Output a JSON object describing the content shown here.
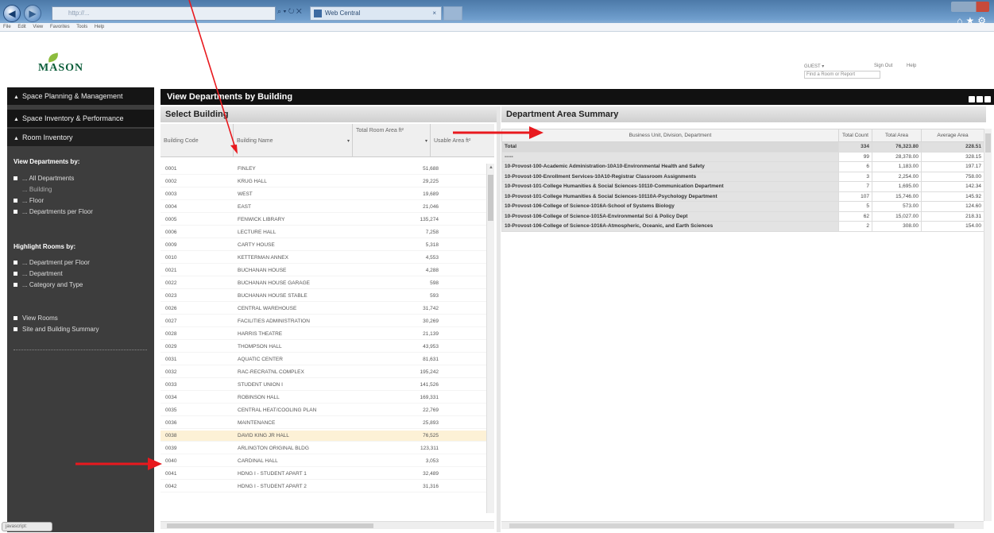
{
  "browser": {
    "address_text": "http://...",
    "tab_label": "Web Central",
    "menu": [
      "File",
      "Edit",
      "View",
      "Favorites",
      "Tools",
      "Help"
    ]
  },
  "header": {
    "logo_text": "MASON",
    "user_label": "GUEST ▾",
    "sign_out": "Sign Out",
    "help": "Help",
    "find_room_placeholder": "Find a Room or Report"
  },
  "sidebar": {
    "sections": [
      "Space Planning & Management",
      "Space Inventory & Performance",
      "Room Inventory"
    ],
    "view_heading": "View Departments by:",
    "view_items": [
      "... All Departments",
      "... Building",
      "... Floor",
      "... Departments per Floor"
    ],
    "highlight_heading": "Highlight Rooms by:",
    "highlight_items": [
      "... Department per Floor",
      "... Department",
      "... Category and Type"
    ],
    "other_items": [
      "View Rooms",
      "Site and Building Summary"
    ]
  },
  "panel": {
    "title": "View Departments by Building"
  },
  "select_building": {
    "title": "Select Building",
    "columns": [
      "Building Code",
      "Building Name",
      "Total Room Area ft²",
      "Usable Area ft²"
    ],
    "rows": [
      {
        "code": "0001",
        "name": "FINLEY",
        "area": "51,688"
      },
      {
        "code": "0002",
        "name": "KRUG HALL",
        "area": "29,225"
      },
      {
        "code": "0003",
        "name": "WEST",
        "area": "19,689"
      },
      {
        "code": "0004",
        "name": "EAST",
        "area": "21,046"
      },
      {
        "code": "0005",
        "name": "FENWICK LIBRARY",
        "area": "135,274"
      },
      {
        "code": "0006",
        "name": "LECTURE HALL",
        "area": "7,258"
      },
      {
        "code": "0009",
        "name": "CARTY HOUSE",
        "area": "5,318"
      },
      {
        "code": "0010",
        "name": "KETTERMAN ANNEX",
        "area": "4,553"
      },
      {
        "code": "0021",
        "name": "BUCHANAN HOUSE",
        "area": "4,288"
      },
      {
        "code": "0022",
        "name": "BUCHANAN HOUSE GARAGE",
        "area": "598"
      },
      {
        "code": "0023",
        "name": "BUCHANAN HOUSE STABLE",
        "area": "593"
      },
      {
        "code": "0026",
        "name": "CENTRAL WAREHOUSE",
        "area": "31,742"
      },
      {
        "code": "0027",
        "name": "FACILITIES ADMINISTRATION",
        "area": "30,269"
      },
      {
        "code": "0028",
        "name": "HARRIS THEATRE",
        "area": "21,139"
      },
      {
        "code": "0029",
        "name": "THOMPSON HALL",
        "area": "43,953"
      },
      {
        "code": "0031",
        "name": "AQUATIC CENTER",
        "area": "81,631"
      },
      {
        "code": "0032",
        "name": "RAC-RECRATNL COMPLEX",
        "area": "195,242"
      },
      {
        "code": "0033",
        "name": "STUDENT UNION I",
        "area": "141,526"
      },
      {
        "code": "0034",
        "name": "ROBINSON HALL",
        "area": "169,331"
      },
      {
        "code": "0035",
        "name": "CENTRAL HEAT/COOLING PLAN",
        "area": "22,769"
      },
      {
        "code": "0036",
        "name": "MAINTENANCE",
        "area": "25,893"
      },
      {
        "code": "0038",
        "name": "DAVID KING JR HALL",
        "area": "76,525"
      },
      {
        "code": "0039",
        "name": "ARLINGTON ORIGINAL BLDG",
        "area": "123,311"
      },
      {
        "code": "0040",
        "name": "CARDINAL HALL",
        "area": "3,053"
      },
      {
        "code": "0041",
        "name": "HDNG I - STUDENT APART 1",
        "area": "32,489"
      },
      {
        "code": "0042",
        "name": "HDNG I - STUDENT APART 2",
        "area": "31,316"
      }
    ],
    "highlight_index": 21
  },
  "dept_summary": {
    "title": "Department Area Summary",
    "columns": [
      "Business Unit, Division, Department",
      "Total Count",
      "Total Area",
      "Average Area"
    ],
    "total": {
      "name": "Total",
      "count": "334",
      "area": "76,323.80",
      "avg": "228.51"
    },
    "rows": [
      {
        "name": "-----",
        "count": "99",
        "area": "28,378.00",
        "avg": "328.15"
      },
      {
        "name": "10-Provost-100-Academic Administration-10A10-Environmental Health and Safety",
        "count": "6",
        "area": "1,183.00",
        "avg": "197.17"
      },
      {
        "name": "10-Provost-100-Enrollment Services-10A10-Registrar Classroom Assignments",
        "count": "3",
        "area": "2,254.00",
        "avg": "758.00"
      },
      {
        "name": "10-Provost-101-College Humanities & Social Sciences-10110-Communication Department",
        "count": "7",
        "area": "1,695.00",
        "avg": "142.34"
      },
      {
        "name": "10-Provost-101-College Humanities & Social Sciences-10110A-Psychology Department",
        "count": "107",
        "area": "15,746.00",
        "avg": "145.92"
      },
      {
        "name": "10-Provost-106-College of Science-1016A-School of Systems Biology",
        "count": "5",
        "area": "573.00",
        "avg": "124.60"
      },
      {
        "name": "10-Provost-106-College of Science-1015A-Environmental Sci & Policy Dept",
        "count": "62",
        "area": "15,027.00",
        "avg": "218.31"
      },
      {
        "name": "10-Provost-106-College of Science-1016A-Atmospheric, Oceanic, and Earth Sciences",
        "count": "2",
        "area": "308.00",
        "avg": "154.00"
      }
    ]
  },
  "status": {
    "zoom_label": "javascript:"
  },
  "colors": {
    "annotation_arrow": "#e8191e",
    "sidebar_bg": "#3d3d3d",
    "highlight_row": "#fdf1d6"
  }
}
